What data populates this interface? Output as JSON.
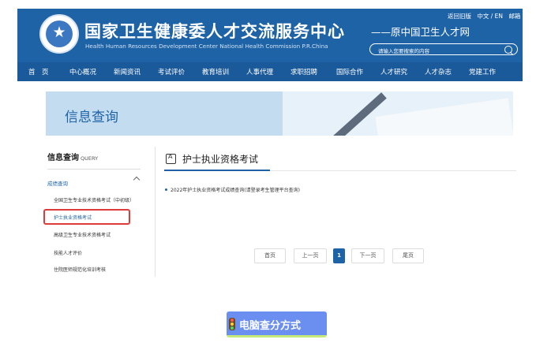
{
  "site": {
    "title_cn": "国家卫生健康委人才交流服务中心",
    "title_en": "Health Human Resources Development Center National Health Commission P.R.China",
    "subtitle": "——原中国卫生人才网",
    "top_links": [
      "返回旧版",
      "中文 / EN",
      "邮箱"
    ],
    "search_placeholder": "请输入您要搜索的内容"
  },
  "nav": [
    "首　页",
    "中心概况",
    "新闻资讯",
    "考试评价",
    "教育培训",
    "人事代理",
    "求职招聘",
    "国际合作",
    "人才研究",
    "人才杂志",
    "党建工作"
  ],
  "banner": {
    "title": "信息查询"
  },
  "sidebar": {
    "title": "信息查询",
    "title_en": "QUERY",
    "category": "成绩查询",
    "items": [
      "全国卫生专业技术资格考试（中初级）",
      "护士执业资格考试",
      "高级卫生专业技术资格考试",
      "技能人才评价",
      "住院医师规范化培训考核"
    ],
    "active_index": 1
  },
  "main": {
    "title": "护士执业资格考试",
    "list": [
      "2022年护士执业资格考试成绩查询(请登录考生管理平台查询)"
    ]
  },
  "pagination": {
    "first": "首页",
    "prev": "上一页",
    "current": "1",
    "next": "下一页",
    "last": "尾页"
  },
  "badge": {
    "text": "电脑查分方式"
  },
  "colors": {
    "primary": "#1f63a7",
    "nav": "#1b5a9a",
    "highlight": "#e03b3b",
    "badge": "#6b8ff1",
    "badge_underline": "#c6ea7a"
  },
  "icons": [
    "emblem-logo",
    "search-icon",
    "chevron-up-icon",
    "exam-doc-icon",
    "traffic-light-icon"
  ]
}
